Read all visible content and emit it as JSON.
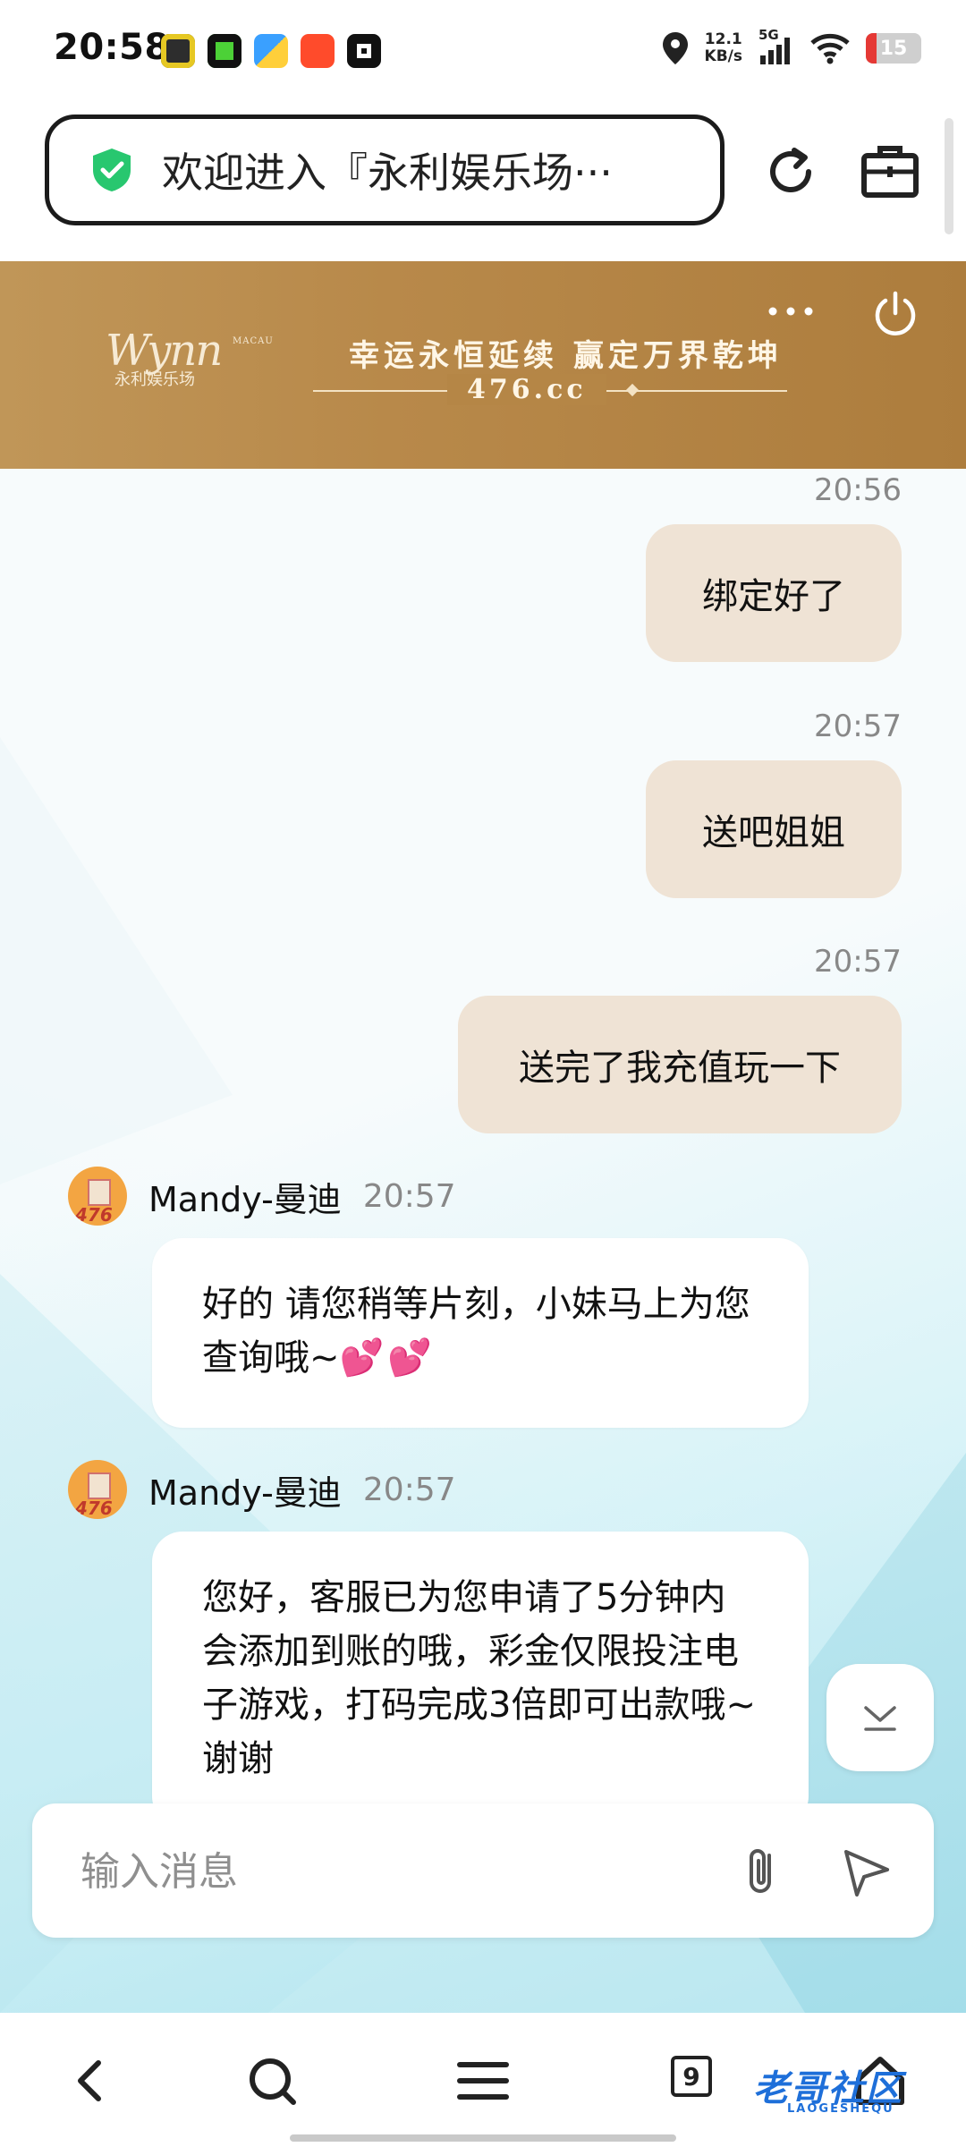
{
  "status_bar": {
    "time": "20:58",
    "net_speed_value": "12.1",
    "net_speed_unit": "KB/s",
    "network_type": "5G",
    "battery": "15",
    "app_icons": [
      "game-app-icon",
      "frog-app-icon",
      "colorful-app-icon",
      "taobao-app-icon",
      "tiktok-app-icon"
    ]
  },
  "browser": {
    "url_title": "欢迎进入『永利娱乐场···"
  },
  "banner": {
    "logo_script": "Wynn",
    "logo_macau": "MACAU",
    "logo_sub": "永利娱乐场",
    "slogan": "幸运永恒延续  赢定万界乾坤",
    "domain": "476.cc",
    "colors": {
      "start": "#c09658",
      "end": "#ad7d3d"
    }
  },
  "chat": {
    "outgoing": [
      {
        "time": "20:56",
        "text": "绑定好了"
      },
      {
        "time": "20:57",
        "text": "送吧姐姐"
      },
      {
        "time": "20:57",
        "text": "送完了我充值玩一下"
      }
    ],
    "incoming": [
      {
        "sender": "Mandy-曼迪",
        "time": "20:57",
        "avatar_label": "476",
        "text": "好的 请您稍等片刻，小妹马上为您查询哦~",
        "emoji": "💕💕"
      },
      {
        "sender": "Mandy-曼迪",
        "time": "20:57",
        "avatar_label": "476",
        "text": "您好，客服已为您申请了5分钟内会添加到账的哦，彩金仅限投注电子游戏，打码完成3倍即可出款哦~谢谢"
      }
    ]
  },
  "composer": {
    "placeholder": "输入消息"
  },
  "bottom_nav": {
    "tab_count": "9",
    "watermark": "老哥社区",
    "watermark_sub": "LAOGESHEQU"
  }
}
